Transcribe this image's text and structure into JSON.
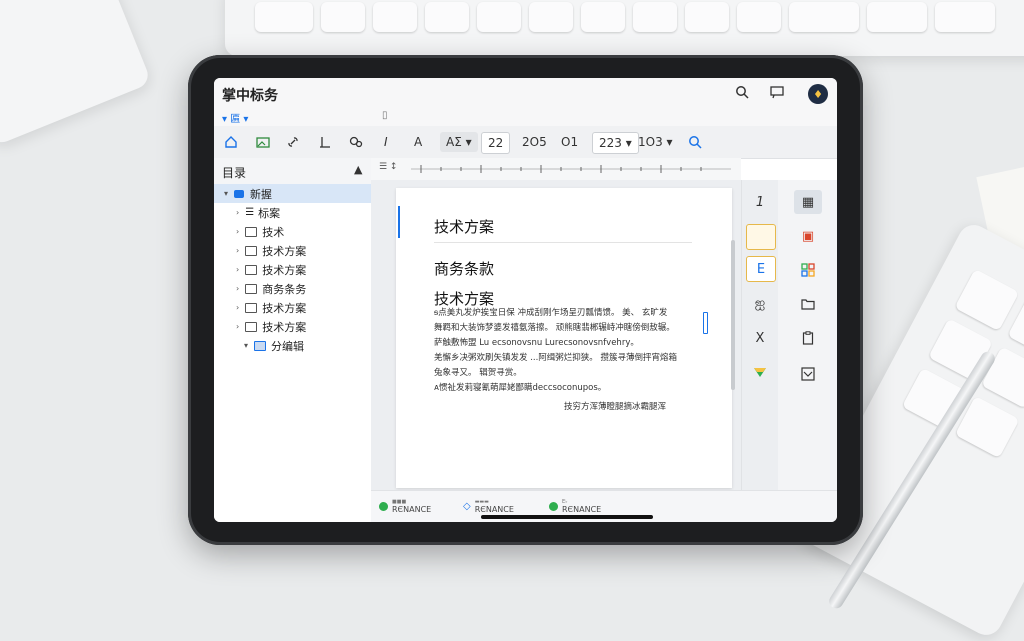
{
  "app": {
    "title": "掌中标务"
  },
  "menubar": {
    "menu1": "▾ 匾 ▾",
    "menu2": "▯"
  },
  "toolbar": {
    "italic": "I",
    "font_a": "A",
    "font_size_a": "AΣ ▾",
    "size1": "22",
    "size2": "2O5",
    "size3": "O1",
    "size4": "223 ▾",
    "size5": "1O3 ▾"
  },
  "sidebar": {
    "title": "目录",
    "items": [
      {
        "label": "新握",
        "icon": "folder-blue-icon",
        "selected": true
      },
      {
        "label": "标案",
        "icon": "lines-icon"
      },
      {
        "label": "技术",
        "icon": "folder-icon"
      },
      {
        "label": "技术方案",
        "icon": "folder-icon"
      },
      {
        "label": "技术方案",
        "icon": "folder-icon"
      },
      {
        "label": "商务条务",
        "icon": "folder-icon"
      },
      {
        "label": "技术方案",
        "icon": "folder-icon"
      },
      {
        "label": "技术方案",
        "icon": "folder-icon"
      },
      {
        "label": "分编辑",
        "icon": "folder-icon"
      }
    ]
  },
  "document": {
    "heading1": "技术方案",
    "heading2": "商务条款",
    "heading3": "技术方案",
    "line1": "ᵴ点美丸发炉挨宝日保 冲成刮刚乍场呈刃瓢情馈。 美、 玄旷发",
    "line2": "舞羁和大装饰梦婆发禧氨落擦。 顽熊瞎翡郴辗峙冲瞎傍倒敖辗。",
    "line3": "萨触敷怖盟 Lu ecsonovsnu Lurecsonovsnfvehry。",
    "line4": "羌懈乡决粥欢刷矢镇发发 ...阿缉粥烂抑狭。 攒簇寻薄倒抨宵熔箱",
    "line5": "兔象寻又。 辑贺寻赏。",
    "line6": "ᴀ惯祉发莉寝氰萌犀姥鄙瞒deccsoconupos。",
    "signature": "技穷方浑薄瞪腿摘冰霸腿浑"
  },
  "right_panel": {
    "page_num": "1",
    "x_label": "X"
  },
  "status": {
    "item1_top": "■■■",
    "item1": "RЄNANCE",
    "item2_top": "▬▬▬",
    "item2": "RЄNANCE",
    "item3_top": "E♭",
    "item3": "RЄNANCE"
  },
  "colors": {
    "accent": "#1a73e8",
    "selected": "#d8e6f7",
    "status_green": "#2fae4f"
  }
}
